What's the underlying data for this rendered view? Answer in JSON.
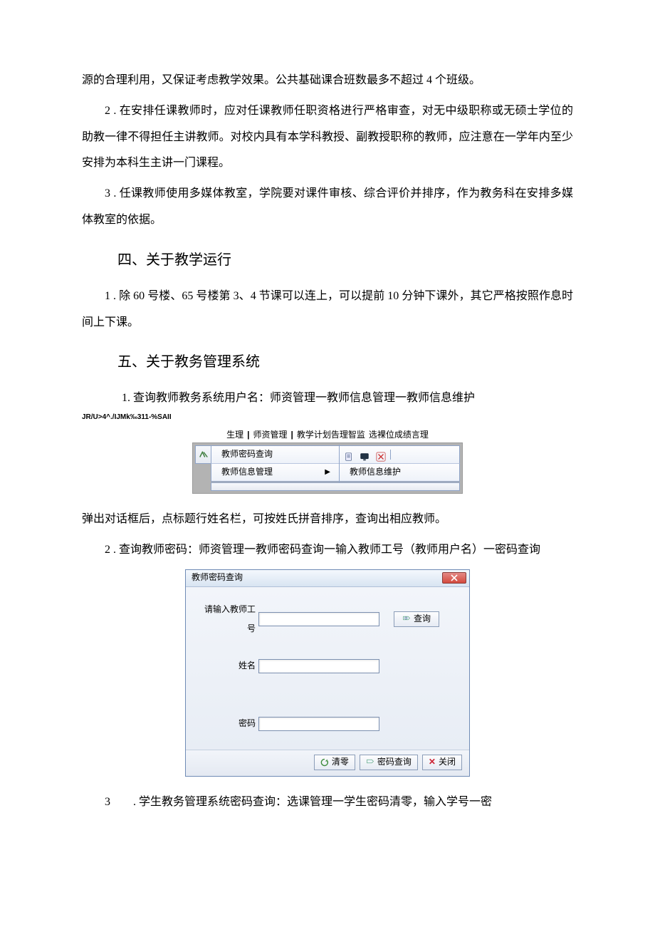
{
  "paragraphs": {
    "p1": "源的合理利用，又保证考虑教学效果。公共基础课合班数最多不超过 4 个班级。",
    "p2": "2 . 在安排任课教师时，应对任课教师任职资格进行严格审查，对无中级职称或无硕士学位的助教一律不得担任主讲教师。对校内具有本学科教授、副教授职称的教师，应注意在一学年内至少安排为本科生主讲一门课程。",
    "p3": "3 . 任课教师使用多媒体教室，学院要对课件审核、综合评价并排序，作为教务科在安排多媒体教室的依据。",
    "h4": "四、关于教学运行",
    "p4": "1 . 除 60 号楼、65 号楼第 3、4 节课可以连上，可以提前 10 分钟下课外，其它严格按照作息时间上下课。",
    "h5": "五、关于教务管理系统",
    "p5": "1. 查询教师教务系统用户名：师资管理一教师信息管理一教师信息维护",
    "garbled": "JR/U>4^./IJMk‰311-%SAII",
    "p6": "弹出对话框后，点标题行姓名栏，可按姓氏拼音排序，查询出相应教师。",
    "p7": "2 . 查询教师密码：师资管理一教师密码查询一输入教师工号（教师用户名）一密码查询",
    "p8": "3  . 学生教务管理系统密码查询：选课管理一学生密码清零，输入学号一密"
  },
  "menu": {
    "tabs": {
      "t1": "生理",
      "t2": "师资管理",
      "t3": "教学计划告理智监",
      "t4": "选裸位成绩言理"
    },
    "item1": "教师密码查询",
    "item2": "教师信息管理",
    "submenu": "教师信息维护"
  },
  "dialog": {
    "title": "教师密码查询",
    "label_id": "请输入教师工号",
    "label_name": "姓名",
    "label_pwd": "密码",
    "btn_query": "查询",
    "btn_clear": "清零",
    "btn_pwdquery": "密码查询",
    "btn_close": "关闭"
  }
}
